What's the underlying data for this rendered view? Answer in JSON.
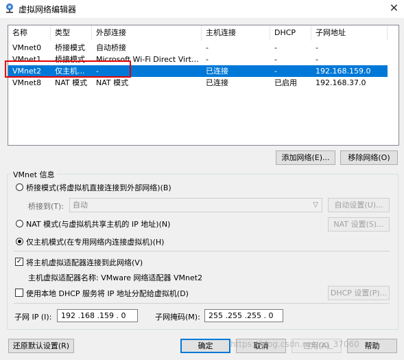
{
  "window": {
    "title": "虚拟网络编辑器",
    "close": "✕"
  },
  "table": {
    "columns": [
      "名称",
      "类型",
      "外部连接",
      "主机连接",
      "DHCP",
      "子网地址"
    ],
    "rows": [
      [
        "VMnet0",
        "桥接模式",
        "自动桥接",
        "-",
        "-",
        "-"
      ],
      [
        "VMnet1",
        "桥接模式",
        "Microsoft Wi-Fi Direct Virtual...",
        "-",
        "-",
        "-"
      ],
      [
        "VMnet2",
        "仅主机...",
        "-",
        "已连接",
        "-",
        "192.168.159.0"
      ],
      [
        "VMnet8",
        "NAT 模式",
        "NAT 模式",
        "已连接",
        "已启用",
        "192.168.37.0"
      ]
    ],
    "selected_row": 2
  },
  "buttons": {
    "add_network": "添加网络(E)...",
    "remove_network": "移除网络(O)",
    "auto_settings": "自动设置(U)...",
    "nat_settings": "NAT 设置(S)...",
    "dhcp_settings": "DHCP 设置(P)...",
    "restore_defaults": "还原默认设置(R)",
    "ok": "确定",
    "cancel": "取消",
    "apply": "应用(A)",
    "help": "帮助"
  },
  "vmnet_info": {
    "group_title": "VMnet 信息",
    "bridged_label": "桥接模式(将虚拟机直接连接到外部网络)(B)",
    "bridge_to_label": "桥接到(T):",
    "bridge_to_value": "自动",
    "nat_label": "NAT 模式(与虚拟机共享主机的 IP 地址)(N)",
    "host_only_label": "仅主机模式(在专用网络内连接虚拟机)(H)",
    "mode_selected": "host_only",
    "connect_adapter_label": "将主机虚拟适配器连接到此网络(V)",
    "connect_adapter_checked": true,
    "adapter_name_label": "主机虚拟适配器名称: VMware 网络适配器 VMnet2",
    "dhcp_label": "使用本地 DHCP 服务将 IP 地址分配给虚拟机(D)",
    "dhcp_checked": false,
    "subnet_ip_label": "子网 IP (I):",
    "subnet_ip_value": "192 .168 .159 . 0",
    "subnet_mask_label": "子网掩码(M):",
    "subnet_mask_value": "255 .255 .255 . 0"
  },
  "watermark": "https://blog.csdn.net/qq_37060"
}
